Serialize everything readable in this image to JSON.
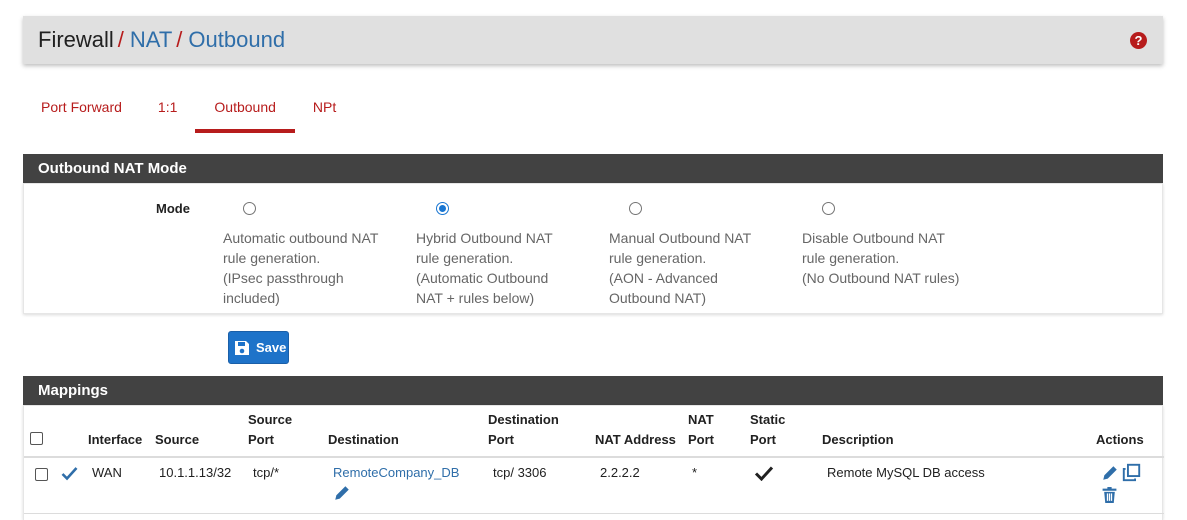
{
  "breadcrumb": {
    "items": [
      "Firewall",
      "NAT",
      "Outbound"
    ],
    "separator": "/",
    "help_icon": "question-circle-icon"
  },
  "tabs": [
    {
      "label": "Port Forward",
      "active": false
    },
    {
      "label": "1:1",
      "active": false
    },
    {
      "label": "Outbound",
      "active": true
    },
    {
      "label": "NPt",
      "active": false
    }
  ],
  "mode_panel": {
    "title": "Outbound NAT Mode",
    "label": "Mode",
    "options": [
      {
        "lines": [
          "Automatic outbound NAT",
          "rule generation.",
          "(IPsec passthrough",
          "included)"
        ],
        "selected": false
      },
      {
        "lines": [
          "Hybrid Outbound NAT",
          "rule generation.",
          "(Automatic Outbound",
          "NAT + rules below)"
        ],
        "selected": true
      },
      {
        "lines": [
          "Manual Outbound NAT",
          "rule generation.",
          "(AON - Advanced",
          "Outbound NAT)"
        ],
        "selected": false
      },
      {
        "lines": [
          "Disable Outbound NAT",
          "rule generation.",
          "(No Outbound NAT rules)"
        ],
        "selected": false
      }
    ]
  },
  "save": {
    "label": "Save",
    "icon": "floppy-disk-icon"
  },
  "mappings": {
    "title": "Mappings",
    "headers": {
      "interface": "Interface",
      "source": "Source",
      "source_port_1": "Source",
      "source_port_2": "Port",
      "destination": "Destination",
      "dest_port_1": "Destination",
      "dest_port_2": "Port",
      "nat_address": "NAT Address",
      "nat_port_1": "NAT",
      "nat_port_2": "Port",
      "static_port_1": "Static",
      "static_port_2": "Port",
      "description": "Description",
      "actions": "Actions"
    },
    "rows": [
      {
        "enabled_icon": "check-icon",
        "interface": "WAN",
        "source": "10.1.1.13/32",
        "source_port": "tcp/*",
        "destination": "RemoteCompany_DB",
        "dest_port": "tcp/ 3306",
        "nat_address": "2.2.2.2",
        "nat_port": "*",
        "static_port_icon": "checkmark-icon",
        "description": "Remote MySQL DB access"
      }
    ]
  },
  "colors": {
    "accent_red": "#b71c1c",
    "link_blue": "#2f6ea9",
    "button_blue": "#1e73c9",
    "panel_header": "#424242"
  }
}
